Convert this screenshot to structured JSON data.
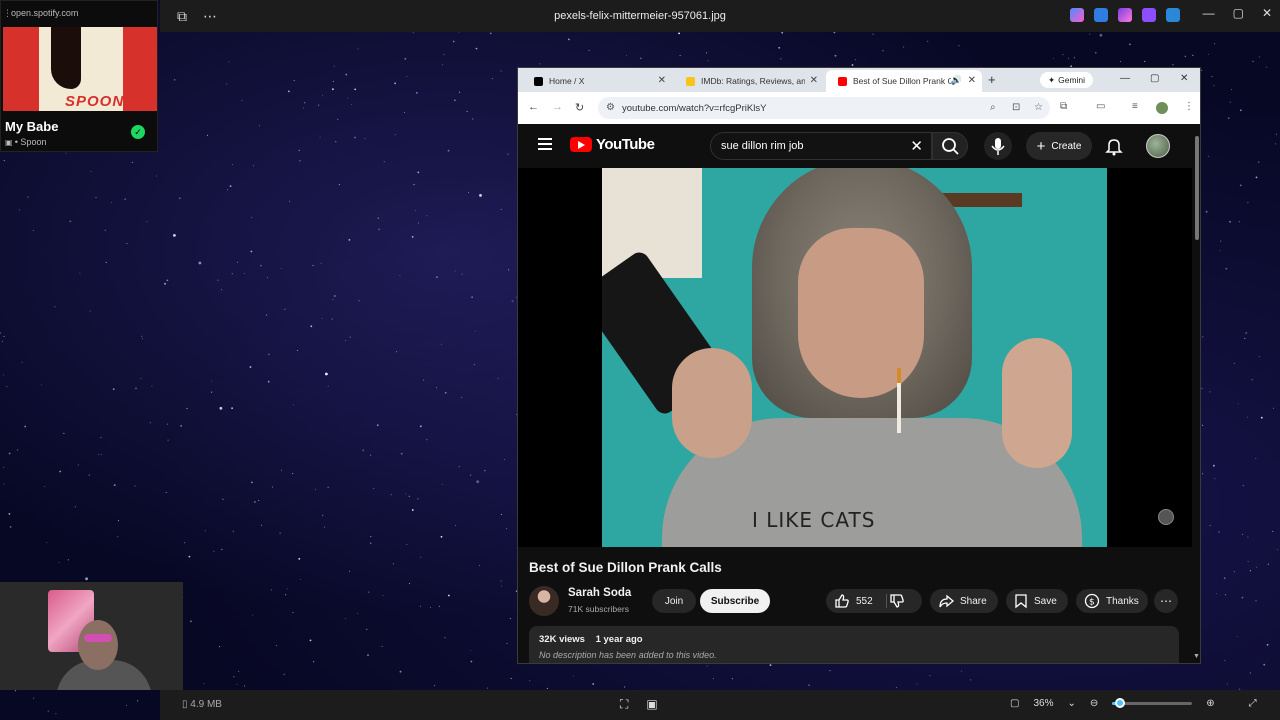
{
  "viewer": {
    "title": "pexels-felix-mittermeier-957061.jpg",
    "file_size": "4.9 MB",
    "zoom": "36%",
    "zoom_level_fraction": 0.1
  },
  "spotify": {
    "url": "open.spotify.com",
    "album_word": "SPOON",
    "song": "My Babe",
    "artist": "• Spoon"
  },
  "browser": {
    "tabs": [
      {
        "label": "Home / X",
        "favicon_color": "#000000",
        "active": false
      },
      {
        "label": "IMDb: Ratings, Reviews, and W",
        "favicon_color": "#f5c518",
        "active": false
      },
      {
        "label": "Best of Sue Dillon Prank C",
        "favicon_color": "#ff0000",
        "active": true
      }
    ],
    "gemini_label": "Gemini",
    "url": "youtube.com/watch?v=rfcgPriKlsY"
  },
  "youtube": {
    "logo_word": "YouTube",
    "search_query": "sue dillon rim job",
    "create_label": "Create",
    "video_title": "Best of Sue Dillon Prank Calls",
    "shirt_text": "I LIKE CATS",
    "channel_name": "Sarah Soda",
    "subscribers": "71K subscribers",
    "join_label": "Join",
    "subscribe_label": "Subscribe",
    "like_count": "552",
    "share_label": "Share",
    "save_label": "Save",
    "thanks_label": "Thanks",
    "views": "32K views",
    "uploaded": "1 year ago",
    "description": "No description has been added to this video."
  },
  "colors": {
    "youtube_red": "#ff0000",
    "spotify_green": "#1ed760",
    "accent_blue": "#4cc2ff"
  }
}
